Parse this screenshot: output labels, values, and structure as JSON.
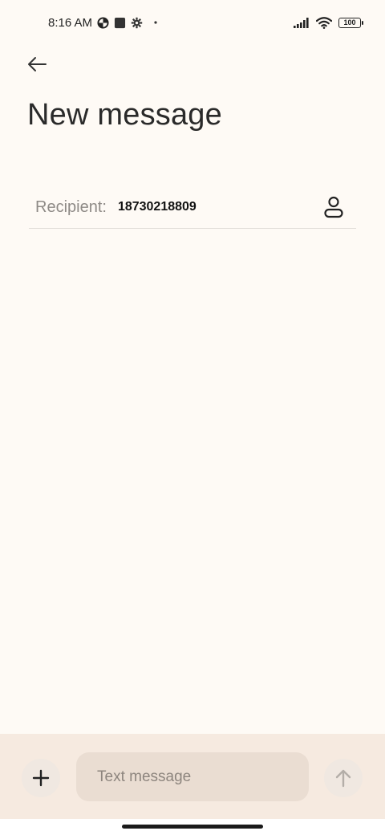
{
  "status_bar": {
    "time": "8:16 AM",
    "battery": "100",
    "icons_left": [
      "data-saver-icon",
      "square-notification-icon",
      "settings-notification-icon",
      "dot-icon"
    ],
    "icons_right": [
      "signal-icon",
      "wifi-icon",
      "battery-icon"
    ]
  },
  "header": {
    "back_icon": "arrow-left-icon",
    "title": "New message"
  },
  "recipient": {
    "label": "Recipient:",
    "value": "18730218809",
    "contact_icon": "person-icon"
  },
  "compose": {
    "add_icon": "plus-icon",
    "placeholder": "Text message",
    "value": "",
    "send_icon": "arrow-up-icon"
  },
  "colors": {
    "background": "#fefaf5",
    "compose_bar": "#f6eae0",
    "input_background": "#eaddd2"
  }
}
